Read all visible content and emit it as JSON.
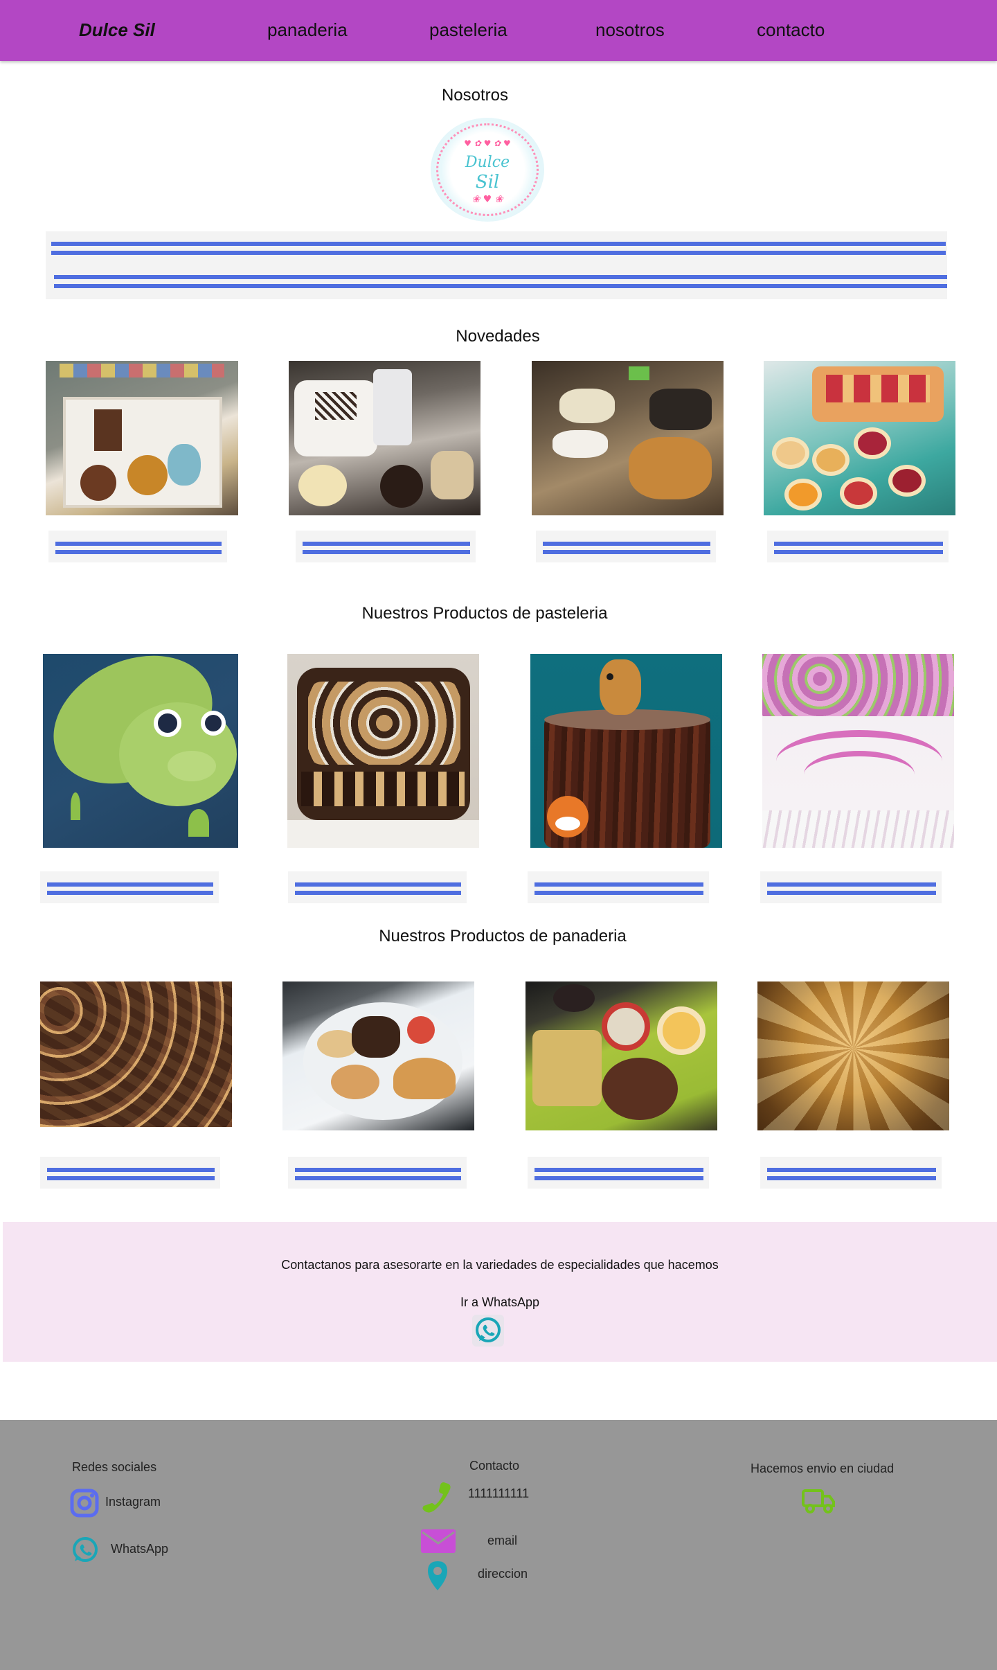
{
  "nav": {
    "brand": "Dulce Sil",
    "links": [
      "panaderia",
      "pasteleria",
      "nosotros",
      "contacto"
    ]
  },
  "about": {
    "title": "Nosotros",
    "logo_text_1": "Dulce",
    "logo_text_2": "Sil"
  },
  "novedades": {
    "title": "Novedades"
  },
  "pasteleria": {
    "title": "Nuestros Productos de pasteleria"
  },
  "panaderia": {
    "title": "Nuestros Productos de panaderia"
  },
  "contact": {
    "text": "Contactanos para asesorarte en la variedades de especialidades que hacemos",
    "whatsapp_link": "Ir a WhatsApp"
  },
  "footer": {
    "social_title": "Redes sociales",
    "instagram": "Instagram",
    "whatsapp": "WhatsApp",
    "contact_title": "Contacto",
    "phone": "1111111111",
    "email": "email",
    "address": "direccion",
    "shipping": "Hacemos envio en ciudad"
  },
  "colors": {
    "nav_bg": "#b347c4",
    "contact_bg": "#f6e5f3",
    "footer_bg": "#979797",
    "placeholder_lines": "#4f6ee0",
    "instagram": "#5b6cf0",
    "whatsapp": "#1aa6b7",
    "phone": "#73c21b",
    "email": "#c84fd6",
    "location": "#1aa6b7",
    "truck": "#73c21b"
  },
  "icons": [
    "instagram-icon",
    "whatsapp-icon",
    "phone-icon",
    "email-icon",
    "location-icon",
    "truck-icon"
  ]
}
